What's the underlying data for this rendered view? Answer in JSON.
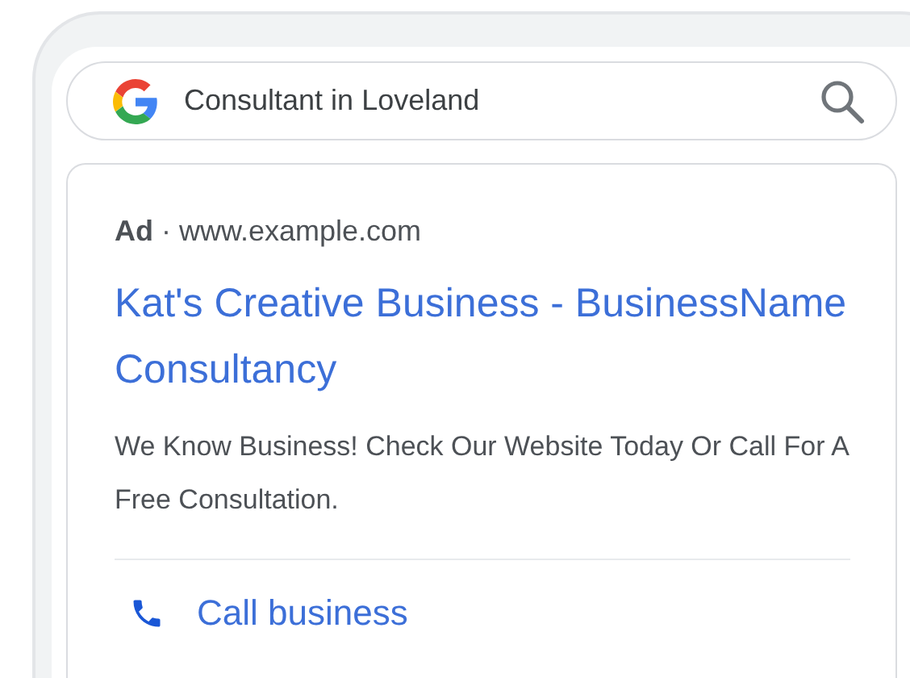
{
  "search": {
    "value": "Consultant in Loveland"
  },
  "ad": {
    "label": "**Ad** · www.example.com",
    "title": "Kat's Creative Business - BusinessName Consultancy",
    "description": "We Know Business! Check Our Website Today Or Call For A Free Consultation.",
    "action": "Call business"
  }
}
